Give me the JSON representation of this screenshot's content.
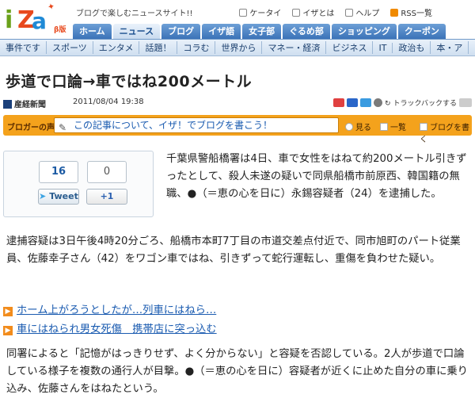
{
  "header": {
    "logo_text": "iZa",
    "logo_beta": "β版",
    "tagline": "ブログで楽しむニュースサイト!!",
    "links": [
      "ケータイ",
      "イザとは",
      "ヘルプ",
      "RSS一覧"
    ]
  },
  "tabs": [
    "ホーム",
    "ニュース",
    "ブログ",
    "イザ語",
    "女子部",
    "ぐるめ部",
    "ショッピング",
    "クーポン"
  ],
  "active_tab": "ニュース",
  "subnav": [
    "事件です",
    "スポーツ",
    "エンタメ",
    "話題！",
    "コラむ",
    "世界から",
    "マネー・経済",
    "ビジネス",
    "IT",
    "政治も",
    "本・ア"
  ],
  "article": {
    "title": "歩道で口論→車ではね200メートル",
    "source": "産経新聞",
    "date": "2011/08/04 19:38",
    "trackback": "トラックバックする",
    "paragraphs": [
      "千葉県警船橋署は4日、車で女性をはねて約200メートル引きずったとして、殺人未遂の疑いで同県船橋市前原西、韓国籍の無職、●（＝恵の心を日に）永錫容疑者（24）を逮捕した。",
      "逮捕容疑は3日午後4時20分ごろ、船橋市本町7丁目の市道交差点付近で、同市旭町のパート従業員、佐藤幸子さん（42）をワゴン車ではね、引きずって蛇行運転し、重傷を負わせた疑い。",
      "同署によると「記憶がはっきりせず、よく分からない」と容疑を否認している。2人が歩道で口論している様子を複数の通行人が目撃。●（＝恵の心を日に）容疑者が近くに止めた自分の車に乗り込み、佐藤さんをはねたという。"
    ],
    "related": [
      "ホーム上がろうとしたが…列車にはねら…",
      "車にはねられ男女死傷　携帯店に突っ込む"
    ]
  },
  "blogbar": {
    "label": "ブロガーの声",
    "prompt": "この記事について、イザ！でブログを書こう！",
    "view": "見る",
    "list": "一覧",
    "write": "ブログを書く"
  },
  "share": {
    "tweet_count": "16",
    "tweet_label": "Tweet",
    "plusone_count": "0",
    "plusone_label": "+1"
  },
  "colors": {
    "accent": "#f4a21c",
    "link": "#1a5bb0",
    "tab": "#3b73b8"
  }
}
